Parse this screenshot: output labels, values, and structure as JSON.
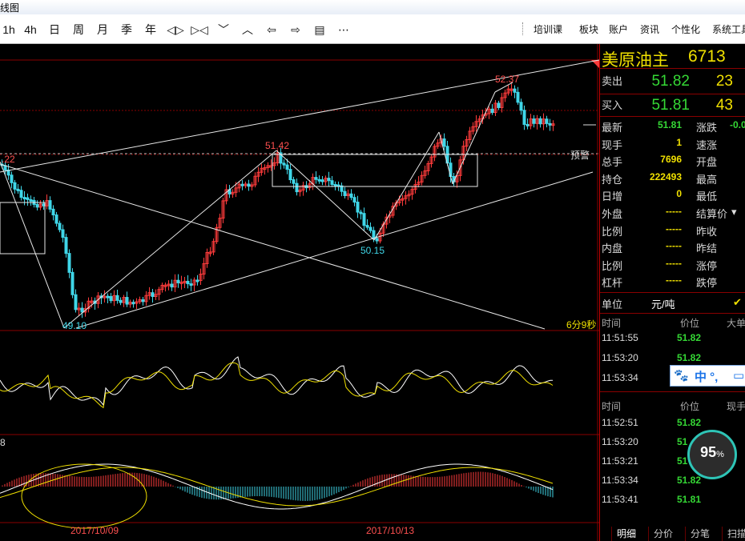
{
  "window": {
    "title": "线图"
  },
  "toolbar": {
    "periods": [
      "1h",
      "4h",
      "日",
      "周",
      "月",
      "季",
      "年"
    ],
    "tools": [
      {
        "icon": "expand-horizontal-icon",
        "glyph": "◁▷"
      },
      {
        "icon": "contract-horizontal-icon",
        "glyph": "▷◁"
      },
      {
        "icon": "chevron-down-icon",
        "glyph": "﹀"
      },
      {
        "icon": "chevron-up-icon",
        "glyph": "︿"
      },
      {
        "icon": "arrow-left-icon",
        "glyph": "⇦"
      },
      {
        "icon": "arrow-right-icon",
        "glyph": "⇨"
      },
      {
        "icon": "layout-icon",
        "glyph": "▤"
      },
      {
        "icon": "more-icon",
        "glyph": "⋯"
      }
    ],
    "right_menu": [
      "培训课",
      "板块",
      "账户",
      "资讯",
      "个性化",
      "系统工具"
    ]
  },
  "instrument": {
    "name": "美原油主",
    "code": "6713"
  },
  "quote": {
    "ask_label": "卖出",
    "ask_price": "51.82",
    "ask_vol": "23",
    "bid_label": "买入",
    "bid_price": "51.81",
    "bid_vol": "43",
    "stats": [
      {
        "l1": "最新",
        "v1": "51.81",
        "c1": "#35d835",
        "l2": "涨跌",
        "v2": "-0.0",
        "c2": "#35d835"
      },
      {
        "l1": "现手",
        "v1": "1",
        "c1": "#f0e000",
        "l2": "速涨",
        "v2": "",
        "c2": "#ddd"
      },
      {
        "l1": "总手",
        "v1": "7696",
        "c1": "#f0e000",
        "l2": "开盘",
        "v2": "",
        "c2": "#ddd"
      },
      {
        "l1": "持仓",
        "v1": "222493",
        "c1": "#f0e000",
        "l2": "最高",
        "v2": "",
        "c2": "#ddd"
      },
      {
        "l1": "日增",
        "v1": "0",
        "c1": "#f0e000",
        "l2": "最低",
        "v2": "",
        "c2": "#ddd"
      },
      {
        "l1": "外盘",
        "v1": "-----",
        "c1": "#f0e000",
        "l2": "结算价",
        "v2": "",
        "c2": "#ddd"
      },
      {
        "l1": "比例",
        "v1": "-----",
        "c1": "#f0e000",
        "l2": "昨收",
        "v2": "",
        "c2": "#ddd"
      },
      {
        "l1": "内盘",
        "v1": "-----",
        "c1": "#f0e000",
        "l2": "昨结",
        "v2": "",
        "c2": "#ddd"
      },
      {
        "l1": "比例",
        "v1": "-----",
        "c1": "#f0e000",
        "l2": "涨停",
        "v2": "",
        "c2": "#ddd"
      },
      {
        "l1": "杠杆",
        "v1": "-----",
        "c1": "#f0e000",
        "l2": "跌停",
        "v2": "",
        "c2": "#ddd"
      }
    ],
    "unit_label": "单位",
    "unit_value": "元/吨"
  },
  "ticks1": {
    "headers": [
      "时间",
      "价位",
      "大单"
    ],
    "rows": [
      [
        "11:51:55",
        "51.82"
      ],
      [
        "11:53:20",
        "51.82"
      ],
      [
        "11:53:34",
        ""
      ]
    ]
  },
  "ticks2": {
    "headers": [
      "时间",
      "价位",
      "现手"
    ],
    "rows": [
      [
        "11:52:51",
        "51.82"
      ],
      [
        "11:53:20",
        "51"
      ],
      [
        "11:53:21",
        "51"
      ],
      [
        "11:53:34",
        "51.82"
      ],
      [
        "11:53:41",
        "51.81"
      ]
    ]
  },
  "bottom_tabs": [
    "明细",
    "分价",
    "分笔",
    "扫描"
  ],
  "ime": {
    "text": "中 °,"
  },
  "gauge": {
    "value": "95",
    "unit": "%"
  },
  "chart": {
    "labels": {
      "p522": "52.37",
      "p5142": "51.42",
      "p5015": "50.15",
      "p4910": "49.10",
      "left_hi": ".22",
      "alert": "预警",
      "countdown": "6分9秒",
      "macd_tag": "8"
    },
    "dates": [
      "2017/10/09",
      "2017/10/13"
    ],
    "colors": {
      "up": "#ff3b3b",
      "down": "#3fd6e8",
      "grid": "#8a0000"
    }
  },
  "chart_data": {
    "type": "candlestick",
    "title": "美原油主",
    "annotated_prices": [
      52.37,
      51.42,
      50.15,
      49.1
    ],
    "x_tick_labels": [
      "2017/10/09",
      "2017/10/13"
    ]
  }
}
